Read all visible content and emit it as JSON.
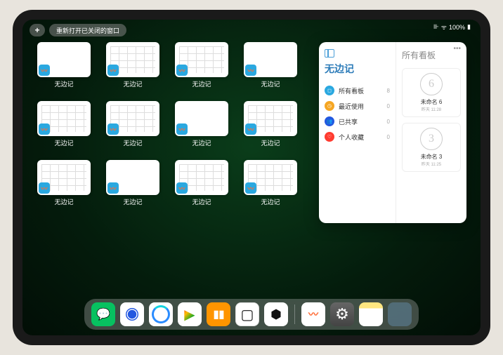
{
  "status": {
    "signal": "⊪",
    "wifi": "ᯤ",
    "battery_text": "100%",
    "battery_icon": "▮"
  },
  "topbar": {
    "plus": "+",
    "reopen_label": "重新打开已关闭的窗口"
  },
  "app_label": "无边记",
  "thumbnails": [
    {
      "style": "blank"
    },
    {
      "style": "cal"
    },
    {
      "style": "cal"
    },
    {
      "style": "blank"
    },
    {
      "style": "cal"
    },
    {
      "style": "cal"
    },
    {
      "style": "blank"
    },
    {
      "style": "cal"
    },
    {
      "style": "cal"
    },
    {
      "style": "blank"
    },
    {
      "style": "cal"
    },
    {
      "style": "cal"
    }
  ],
  "panel": {
    "left_title": "无边记",
    "right_title": "所有看板",
    "items": [
      {
        "icon_bg": "#2aa8e0",
        "glyph": "◻",
        "label": "所有看板",
        "count": "8"
      },
      {
        "icon_bg": "#f5a623",
        "glyph": "◷",
        "label": "最近使用",
        "count": "0"
      },
      {
        "icon_bg": "#2358e0",
        "glyph": "👥",
        "label": "已共享",
        "count": "0"
      },
      {
        "icon_bg": "#ff3b30",
        "glyph": "♡",
        "label": "个人收藏",
        "count": "0"
      }
    ],
    "boards": [
      {
        "sketch": "6",
        "name": "未命名 6",
        "sub": "昨天 11:28"
      },
      {
        "sketch": "3",
        "name": "未命名 3",
        "sub": "昨天 11:25"
      }
    ]
  },
  "dock": [
    {
      "name": "wechat"
    },
    {
      "name": "quark"
    },
    {
      "name": "qqbrowser"
    },
    {
      "name": "play"
    },
    {
      "name": "books"
    },
    {
      "name": "dice"
    },
    {
      "name": "obs"
    },
    {
      "name": "sep"
    },
    {
      "name": "freeform"
    },
    {
      "name": "settings"
    },
    {
      "name": "notes"
    },
    {
      "name": "folder"
    }
  ]
}
